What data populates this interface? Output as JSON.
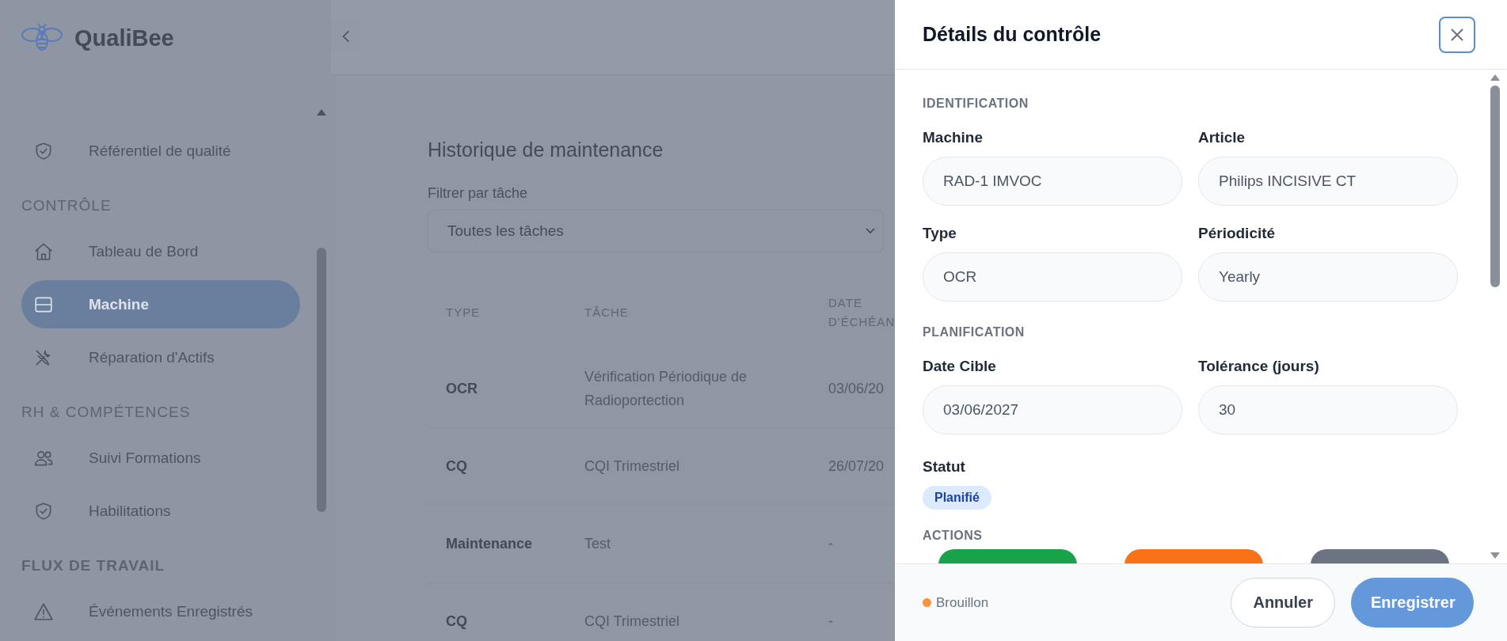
{
  "app": {
    "name": "QualiBee"
  },
  "sidebar": {
    "sections": [
      {
        "items": [
          {
            "label": "Référentiel de qualité",
            "kind": "shield",
            "selected": false
          }
        ]
      },
      {
        "title": "CONTRÔLE",
        "items": [
          {
            "label": "Tableau de Bord",
            "kind": "home",
            "selected": false
          },
          {
            "label": "Machine",
            "kind": "server",
            "selected": true
          },
          {
            "label": "Réparation d'Actifs",
            "kind": "tools",
            "selected": false
          }
        ]
      },
      {
        "title": "RH & COMPÉTENCES",
        "items": [
          {
            "label": "Suivi Formations",
            "kind": "users",
            "selected": false
          },
          {
            "label": "Habilitations",
            "kind": "shield",
            "selected": false
          }
        ]
      },
      {
        "title": "FLUX DE TRAVAIL",
        "items": [
          {
            "label": "Événements Enregistrés",
            "kind": "warning",
            "selected": false
          }
        ]
      }
    ]
  },
  "main": {
    "title": "Historique de maintenance",
    "filter": {
      "label": "Filtrer par tâche",
      "value": "Toutes les tâches"
    },
    "table": {
      "columns": [
        "TYPE",
        "TÂCHE",
        "DATE D'ÉCHÉAN"
      ],
      "rows": [
        [
          "OCR",
          "Vérification Périodique de Radioportection",
          "03/06/20"
        ],
        [
          "CQ",
          "CQI Trimestriel",
          "26/07/20"
        ],
        [
          "Maintenance",
          "Test",
          "-"
        ],
        [
          "CQ",
          "CQI Trimestriel",
          "-"
        ]
      ]
    }
  },
  "drawer": {
    "title": "Détails du contrôle",
    "sections": [
      {
        "title": "IDENTIFICATION",
        "fields": [
          {
            "label": "Machine",
            "value": "RAD-1 IMVOC"
          },
          {
            "label": "Article",
            "value": "Philips INCISIVE CT"
          },
          {
            "label": "Type",
            "value": "OCR"
          },
          {
            "label": "Périodicité",
            "value": "Yearly"
          }
        ]
      },
      {
        "title": "PLANIFICATION",
        "fields": [
          {
            "label": "Date Cible",
            "value": "03/06/2027"
          },
          {
            "label": "Tolérance (jours)",
            "value": "30"
          }
        ]
      }
    ],
    "status": {
      "label": "Statut",
      "value": "Planifié"
    },
    "actions": {
      "title": "ACTIONS",
      "buttons": [
        {
          "color": "#16a34a"
        },
        {
          "color": "#f97316"
        },
        {
          "color": "#6b7280"
        }
      ]
    },
    "footer": {
      "state": {
        "label": "Brouillon",
        "color": "#fb923c"
      },
      "buttons": [
        {
          "label": "Annuler",
          "kind": "secondary"
        },
        {
          "label": "Enregistrer",
          "kind": "primary"
        }
      ]
    }
  }
}
